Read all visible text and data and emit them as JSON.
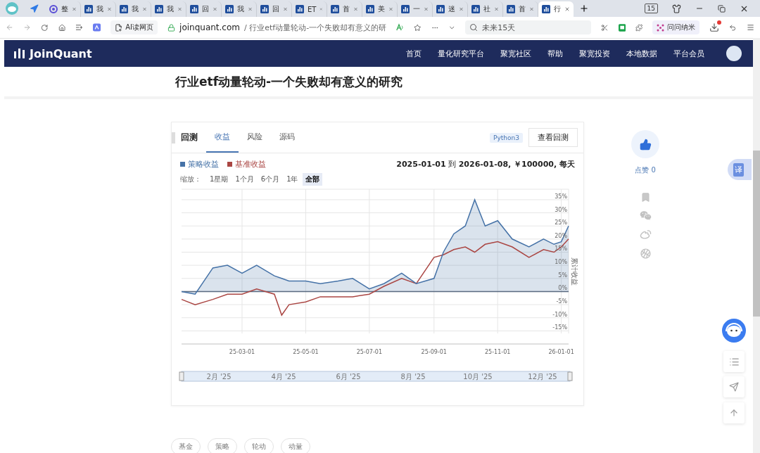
{
  "browser": {
    "tabs": [
      {
        "title": "整",
        "kind": "swirl",
        "selected": false
      },
      {
        "title": "我",
        "kind": "chart",
        "selected": false
      },
      {
        "title": "我",
        "kind": "chart",
        "selected": false
      },
      {
        "title": "我",
        "kind": "chart",
        "selected": false
      },
      {
        "title": "回",
        "kind": "chart",
        "selected": false
      },
      {
        "title": "我",
        "kind": "chart",
        "selected": false
      },
      {
        "title": "回",
        "kind": "chart",
        "selected": false
      },
      {
        "title": "ET",
        "kind": "chart",
        "selected": false
      },
      {
        "title": "首",
        "kind": "chart",
        "selected": false
      },
      {
        "title": "美",
        "kind": "chart",
        "selected": false
      },
      {
        "title": "一",
        "kind": "chart",
        "selected": false
      },
      {
        "title": "迷",
        "kind": "chart",
        "selected": false
      },
      {
        "title": "社",
        "kind": "chart",
        "selected": false
      },
      {
        "title": "首",
        "kind": "chart",
        "selected": false
      },
      {
        "title": "行",
        "kind": "chart",
        "selected": true
      }
    ],
    "tab_count": "15",
    "toolbar": {
      "ai_reader": "AI读网页",
      "url_host": "joinquant.com",
      "url_path": "/ 行业etf动量轮动-一个失败却有意义的研",
      "search": {
        "value": "未来15天"
      },
      "assistant": "问问纳米",
      "download_notification": true
    }
  },
  "site": {
    "logo": "JoinQuant",
    "nav": [
      "首页",
      "量化研究平台",
      "聚宽社区",
      "帮助",
      "聚宽投资",
      "本地数据",
      "平台会员"
    ]
  },
  "article": {
    "title": "行业etf动量轮动-一个失败却有意义的研究",
    "backtest": {
      "heading": "回测",
      "tabs": [
        {
          "label": "收益",
          "selected": true
        },
        {
          "label": "风险",
          "selected": false
        },
        {
          "label": "源码",
          "selected": false
        }
      ],
      "language": "Python3",
      "view_button": "查看回测",
      "summary": "**2025-01-01** 到 **2026-01-08, ￥100000, 每天**",
      "zoom": {
        "label": "缩放：",
        "options": [
          {
            "label": "1星期",
            "selected": false
          },
          {
            "label": "1个月",
            "selected": false
          },
          {
            "label": "6个月",
            "selected": false
          },
          {
            "label": "1年",
            "selected": false
          },
          {
            "label": "全部",
            "selected": true
          }
        ]
      },
      "chart_data": {
        "type": "line",
        "grid": true,
        "ylabel": "累计收益",
        "x": [
          "2025-01-02",
          "2025-01-15",
          "2025-02-01",
          "2025-02-15",
          "2025-03-01",
          "2025-03-15",
          "2025-04-01",
          "2025-04-08",
          "2025-04-15",
          "2025-05-01",
          "2025-05-15",
          "2025-06-01",
          "2025-06-15",
          "2025-07-01",
          "2025-07-15",
          "2025-08-01",
          "2025-08-15",
          "2025-09-01",
          "2025-09-10",
          "2025-09-20",
          "2025-10-01",
          "2025-10-10",
          "2025-10-20",
          "2025-11-01",
          "2025-11-15",
          "2025-12-01",
          "2025-12-15",
          "2025-12-25",
          "2026-01-01",
          "2026-01-08"
        ],
        "series": [
          {
            "name": "策略收益",
            "color": "#4572a7",
            "values": [
              0,
              -1,
              9,
              10,
              7,
              10,
              6,
              5,
              4,
              4,
              3,
              4,
              5,
              1,
              3,
              7,
              3,
              5,
              15,
              22,
              25,
              35,
              25,
              27,
              20,
              17,
              20,
              18,
              19,
              25
            ]
          },
          {
            "name": "基准收益",
            "color": "#aa4643",
            "values": [
              -3,
              -5,
              -3,
              -1,
              -1,
              1,
              -1,
              -9,
              -5,
              -4,
              -2,
              -2,
              -2,
              -1,
              2,
              5,
              3,
              13,
              14,
              16,
              17,
              15,
              18,
              19,
              17,
              13,
              16,
              15,
              17,
              20
            ]
          }
        ],
        "xlim": [
          "2025-01-02",
          "2026-01-08"
        ],
        "ylim": [
          -20,
          39
        ],
        "xticks": [
          {
            "value": "2025-03-01",
            "label": "25-03-01"
          },
          {
            "value": "2025-05-01",
            "label": "25-05-01"
          },
          {
            "value": "2025-07-01",
            "label": "25-07-01"
          },
          {
            "value": "2025-09-01",
            "label": "25-09-01"
          },
          {
            "value": "2025-11-01",
            "label": "25-11-01"
          },
          {
            "value": "2026-01-01",
            "label": "26-01-01"
          }
        ],
        "yticks": [
          {
            "value": -15,
            "label": "-15%"
          },
          {
            "value": -10,
            "label": "-10%"
          },
          {
            "value": -5,
            "label": "-5%"
          },
          {
            "value": 0,
            "label": "0%"
          },
          {
            "value": 5,
            "label": "5%"
          },
          {
            "value": 10,
            "label": "10%"
          },
          {
            "value": 15,
            "label": "15%"
          },
          {
            "value": 20,
            "label": "20%"
          },
          {
            "value": 25,
            "label": "25%"
          },
          {
            "value": 30,
            "label": "30%"
          },
          {
            "value": 35,
            "label": "35%"
          }
        ]
      },
      "navigator": {
        "labels": [
          "2月 '25",
          "4月 '25",
          "6月 '25",
          "8月 '25",
          "10月 '25",
          "12月 '25"
        ]
      }
    },
    "tags": [
      "基金",
      "策略",
      "轮动",
      "动量"
    ]
  },
  "side": {
    "like_label": "点赞 0"
  },
  "floating": {
    "translate": "译"
  }
}
